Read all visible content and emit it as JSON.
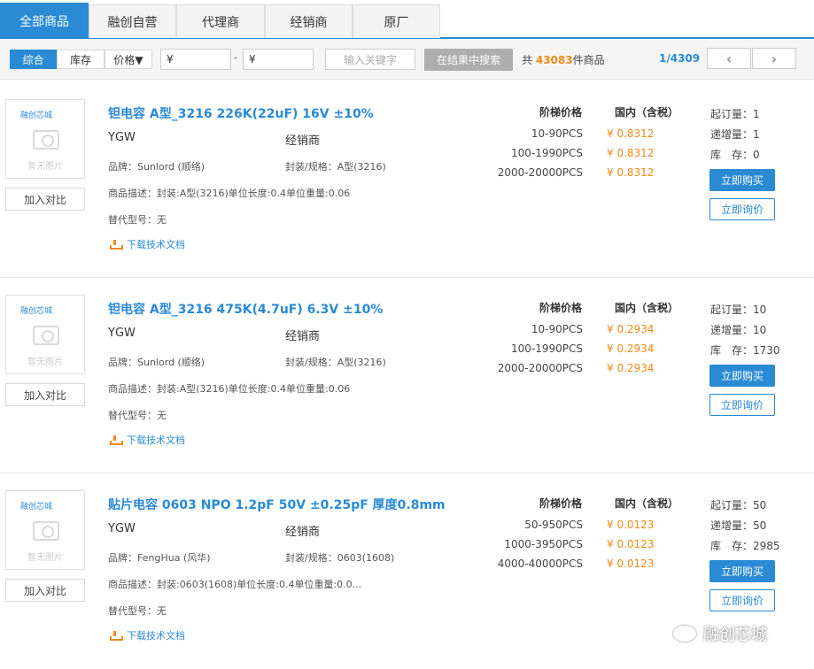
{
  "tabs": [
    "全部商品",
    "融创自营",
    "代理商",
    "经销商",
    "原厂"
  ],
  "filter": {
    "sort": [
      "综合",
      "库存",
      "价格▼"
    ],
    "price_from": "¥",
    "price_to": "¥",
    "dash": "-",
    "keyword_placeholder": "输入关键字",
    "search_btn": "在结果中搜索",
    "total_prefix": "共",
    "total_count": "43083",
    "total_suffix": "件商品",
    "page": "1/4309",
    "prev": "‹",
    "next": "›"
  },
  "labels": {
    "tier_price": "阶梯价格",
    "domestic": "国内（含税）",
    "moq_label": "起订量：",
    "step_label": "递增量：",
    "stock_label": "库　存：",
    "buy": "立即购买",
    "inquire": "立即询价",
    "compare": "加入对比",
    "download": "下载技术文档",
    "no_pic": "暂无图片",
    "logo": "融创芯城"
  },
  "products": [
    {
      "title": "钽电容 A型_3216 226K(22uF) 16V ±10%",
      "manufacturer_code": "YGW",
      "seller_type": "经销商",
      "brand": "品牌：Sunlord (顺络)",
      "package": "封装/规格：A型(3216)",
      "desc": "商品描述：封装:A型(3216)单位长度:0.4单位重量:0.06",
      "alt": "替代型号：无",
      "tiers": [
        {
          "qty": "10-90PCS",
          "price": "¥ 0.8312"
        },
        {
          "qty": "100-1990PCS",
          "price": "¥ 0.8312"
        },
        {
          "qty": "2000-20000PCS",
          "price": "¥ 0.8312"
        }
      ],
      "moq": "1",
      "step": "1",
      "stock": "0"
    },
    {
      "title": "钽电容 A型_3216 475K(4.7uF) 6.3V ±10%",
      "manufacturer_code": "YGW",
      "seller_type": "经销商",
      "brand": "品牌：Sunlord (顺络)",
      "package": "封装/规格：A型(3216)",
      "desc": "商品描述：封装:A型(3216)单位长度:0.4单位重量:0.06",
      "alt": "替代型号：无",
      "tiers": [
        {
          "qty": "10-90PCS",
          "price": "¥ 0.2934"
        },
        {
          "qty": "100-1990PCS",
          "price": "¥ 0.2934"
        },
        {
          "qty": "2000-20000PCS",
          "price": "¥ 0.2934"
        }
      ],
      "moq": "10",
      "step": "10",
      "stock": "1730"
    },
    {
      "title": "贴片电容 0603 NPO 1.2pF 50V ±0.25pF 厚度0.8mm",
      "manufacturer_code": "YGW",
      "seller_type": "经销商",
      "brand": "品牌：FengHua (风华)",
      "package": "封装/规格：0603(1608)",
      "desc": "商品描述：封装:0603(1608)单位长度:0.4单位重量:0.0...",
      "alt": "替代型号：无",
      "tiers": [
        {
          "qty": "50-950PCS",
          "price": "¥ 0.0123"
        },
        {
          "qty": "1000-3950PCS",
          "price": "¥ 0.0123"
        },
        {
          "qty": "4000-40000PCS",
          "price": "¥ 0.0123"
        }
      ],
      "moq": "50",
      "step": "50",
      "stock": "2985"
    }
  ],
  "watermark": "融创芯城"
}
